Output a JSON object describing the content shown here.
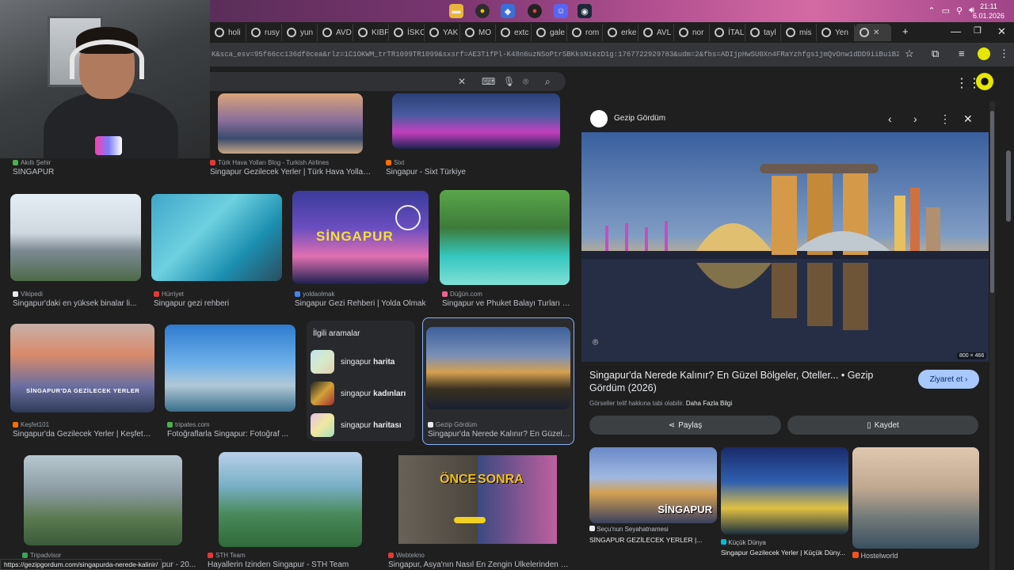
{
  "taskbar": {
    "clock_time": "21:11",
    "clock_date": "6.01.2026"
  },
  "tabs": [
    "holi",
    "rusy",
    "yun",
    "AVD",
    "KIBF",
    "İSKC",
    "YAK",
    "MO",
    "extc",
    "gale",
    "rom",
    "erke",
    "AVL",
    "nor",
    "İTAL",
    "tayl",
    "mis",
    "Yen",
    ""
  ],
  "address": {
    "url": "K&sca_esv=95f66cc136df0cea&rlz=1C1OKWM_trTR1099TR1099&sxsrf=AE3TifPl-K48n6uzNSoPtrSBKksNiezD1g:1767722929783&udm=2&fbs=ADIjpHwSU0Xn4FRaYzhfgs1jmQvOnw1dDD9iiBuiB2fsjeHv6Suaj0u..."
  },
  "results": {
    "row1": [
      {
        "source": "Akıllı Şehir",
        "caption": "SİNGAPUR"
      },
      {
        "source": "Türk Hava Yolları Blog - Turkish Airlines",
        "caption": "Singapur Gezilecek Yerler | Türk Hava Yolları..."
      },
      {
        "source": "Sixt",
        "caption": "Singapur - Sixt Türkiye"
      }
    ],
    "row2": [
      {
        "source": "Vikipedi",
        "caption": "Singapur'daki en yüksek binalar li..."
      },
      {
        "source": "Hürriyet",
        "caption": "Singapur gezi rehberi"
      },
      {
        "source": "yoldaolmak",
        "caption": "Singapur Gezi Rehberi | Yolda Olmak",
        "overlay": "SİNGAPUR"
      },
      {
        "source": "Düğün.com",
        "caption": "Singapur ve Phuket Balayı Turları |..."
      }
    ],
    "row3": [
      {
        "source": "Keşfet101",
        "caption": "Singapur'da Gezilecek Yerler | Keşfet1...",
        "overlay": "SİNGAPUR'DA GEZİLECEK YERLER"
      },
      {
        "source": "tripates.com",
        "caption": "Fotoğraflarla Singapur: Fotoğraf ..."
      },
      {
        "source": "Gezip Gördüm",
        "caption": "Singapur'da Nerede Kalınır? En Güzel ..."
      }
    ],
    "row4": [
      {
        "source": "Tripadvisor",
        "caption": "...pur - 20..."
      },
      {
        "source": "STH Team",
        "caption": "Hayallerin İzinden Singapur - STH Team"
      },
      {
        "source": "Webtekno",
        "caption": "Singapur, Asya'nın Nasıl En Zengin Ülkelerinden O...",
        "overlay_before": "ÖNCE",
        "overlay_after": "SONRA"
      }
    ]
  },
  "related_searches": {
    "title": "İlgili aramalar",
    "items": [
      {
        "prefix": "singapur",
        "bold": "harita"
      },
      {
        "prefix": "singapur",
        "bold": "kadınları"
      },
      {
        "prefix": "singapur",
        "bold": "haritası"
      }
    ]
  },
  "preview": {
    "source_name": "Gezip Gördüm",
    "image_dims": "800 × 466",
    "title": "Singapur'da Nerede Kalınır? En Güzel Bölgeler, Oteller... • Gezip Gördüm (2026)",
    "visit_label": "Ziyaret et",
    "copyright_text": "Görseller telif hakkına tabi olabilir.",
    "copyright_link": "Daha Fazla Bilgi",
    "share_label": "Paylaş",
    "save_label": "Kaydet",
    "related": [
      {
        "source": "Seçu'nun Seyahatnamesi",
        "caption": "SİNGAPUR GEZİLECEK YERLER |...",
        "overlay": "SİNGAPUR"
      },
      {
        "source": "Küçük Dünya",
        "caption": "Singapur Gezilecek Yerler | Küçük Düny..."
      },
      {
        "source": "Hostelworld",
        "caption": ""
      }
    ]
  },
  "status_url": "https://gezipgordum.com/singapurda-nerede-kalinir/",
  "colors": {
    "accent": "#8ab4f8",
    "visit_button": "#a8c7fa",
    "background": "#1f1f1f"
  }
}
